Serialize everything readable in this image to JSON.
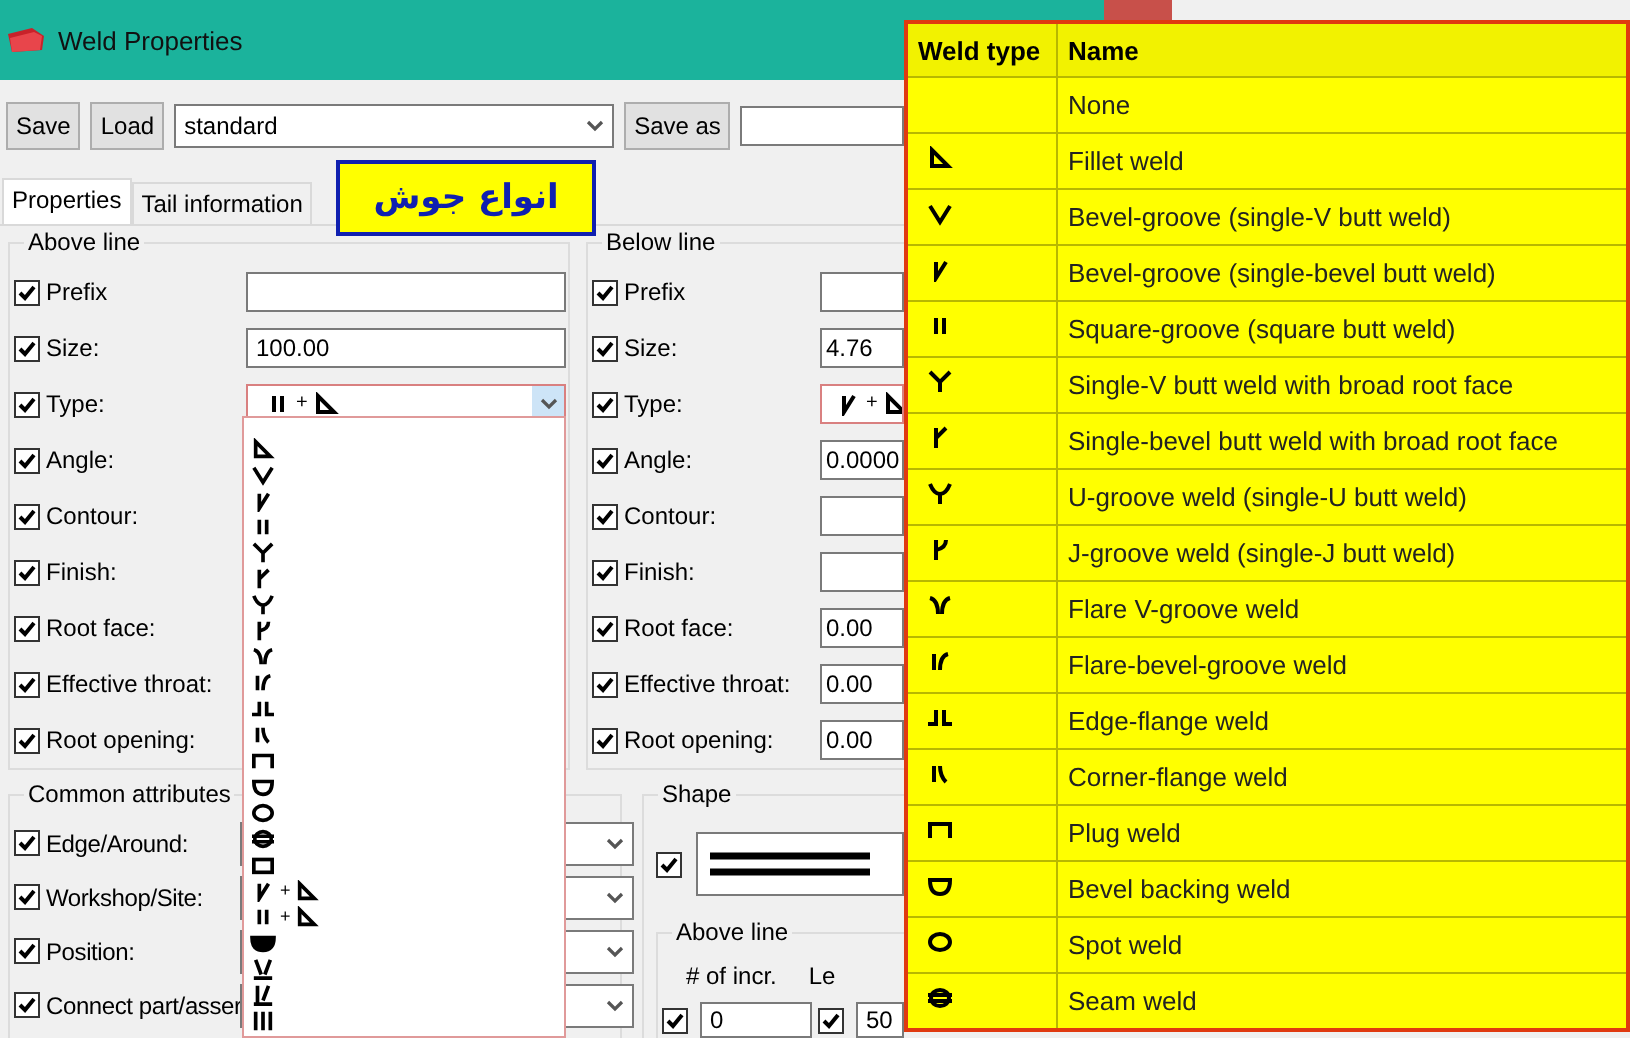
{
  "window": {
    "title": "Weld Properties"
  },
  "toolbar": {
    "buttons": [
      "Save",
      "Load"
    ],
    "preset": "standard",
    "save_as": "Save as"
  },
  "tabs": [
    {
      "label": "Properties",
      "selected": true
    },
    {
      "label": "Tail information",
      "selected": false
    }
  ],
  "annotation": "انواع جوش",
  "above_line": {
    "title": "Above line",
    "rows": [
      {
        "label": "Prefix",
        "checked": true,
        "kind": "text"
      },
      {
        "label": "Size:",
        "checked": true,
        "kind": "text",
        "value": "100.00"
      },
      {
        "label": "Type:",
        "checked": true,
        "kind": "type",
        "symbol": {
          "kind": "square_fillet",
          "joiner": "+"
        }
      },
      {
        "label": "Angle:",
        "checked": true,
        "kind": "plain"
      },
      {
        "label": "Contour:",
        "checked": true,
        "kind": "plain"
      },
      {
        "label": "Finish:",
        "checked": true,
        "kind": "plain"
      },
      {
        "label": "Root face:",
        "checked": true,
        "kind": "plain"
      },
      {
        "label": "Effective throat:",
        "checked": true,
        "kind": "plain"
      },
      {
        "label": "Root opening:",
        "checked": true,
        "kind": "plain"
      }
    ],
    "type_list": [
      {
        "kind": "fillet"
      },
      {
        "kind": "v"
      },
      {
        "kind": "bevel"
      },
      {
        "kind": "square"
      },
      {
        "kind": "y"
      },
      {
        "kind": "bevel_root"
      },
      {
        "kind": "u"
      },
      {
        "kind": "j"
      },
      {
        "kind": "flare_v"
      },
      {
        "kind": "flare_bevel"
      },
      {
        "kind": "edge_flange"
      },
      {
        "kind": "corner_flange"
      },
      {
        "kind": "plug"
      },
      {
        "kind": "bevel_backing"
      },
      {
        "kind": "spot"
      },
      {
        "kind": "seam"
      },
      {
        "kind": "rect"
      },
      {
        "kind": "bevel_fillet",
        "joiner": "+"
      },
      {
        "kind": "square_fillet",
        "joiner": "+"
      },
      {
        "kind": "melt"
      },
      {
        "kind": "v_bar"
      },
      {
        "kind": "bevel_bar"
      },
      {
        "kind": "triple"
      }
    ]
  },
  "below_line": {
    "title": "Below line",
    "rows": [
      {
        "label": "Prefix",
        "checked": true,
        "kind": "text"
      },
      {
        "label": "Size:",
        "checked": true,
        "kind": "text",
        "value": "4.76"
      },
      {
        "label": "Type:",
        "checked": true,
        "kind": "type",
        "symbol": {
          "kind": "bevel_fillet",
          "joiner": "+"
        }
      },
      {
        "label": "Angle:",
        "checked": true,
        "kind": "text",
        "value": "0.0000"
      },
      {
        "label": "Contour:",
        "checked": true,
        "kind": "text"
      },
      {
        "label": "Finish:",
        "checked": true,
        "kind": "text"
      },
      {
        "label": "Root face:",
        "checked": true,
        "kind": "text",
        "value": "0.00"
      },
      {
        "label": "Effective throat:",
        "checked": true,
        "kind": "text",
        "value": "0.00"
      },
      {
        "label": "Root opening:",
        "checked": true,
        "kind": "text",
        "value": "0.00"
      }
    ]
  },
  "common_attributes": {
    "title": "Common attributes",
    "rows": [
      {
        "label": "Edge/Around:",
        "checked": true
      },
      {
        "label": "Workshop/Site:",
        "checked": true
      },
      {
        "label": "Position:",
        "checked": true
      },
      {
        "label": "Connect part/asser",
        "checked": true
      }
    ]
  },
  "shape": {
    "title": "Shape",
    "checked": true,
    "above_line": {
      "title": "Above line",
      "columns": [
        "# of incr.",
        "Le"
      ],
      "fields": [
        {
          "checked": true,
          "value": "0"
        },
        {
          "checked": true,
          "value": "50"
        }
      ]
    }
  },
  "weld_types": {
    "columns": [
      "Weld type",
      "Name"
    ],
    "rows": [
      {
        "name": "None"
      },
      {
        "name": "Fillet weld",
        "kind": "fillet"
      },
      {
        "name": "Bevel-groove (single-V butt weld)",
        "kind": "v"
      },
      {
        "name": "Bevel-groove (single-bevel butt weld)",
        "kind": "bevel"
      },
      {
        "name": "Square-groove (square butt weld)",
        "kind": "square"
      },
      {
        "name": "Single-V butt weld with broad root face",
        "kind": "y"
      },
      {
        "name": "Single-bevel butt weld with broad root face",
        "kind": "bevel_root"
      },
      {
        "name": "U-groove weld (single-U butt weld)",
        "kind": "u"
      },
      {
        "name": "J-groove weld (single-J butt weld)",
        "kind": "j"
      },
      {
        "name": "Flare V-groove weld",
        "kind": "flare_v"
      },
      {
        "name": "Flare-bevel-groove weld",
        "kind": "flare_bevel"
      },
      {
        "name": "Edge-flange weld",
        "kind": "edge_flange"
      },
      {
        "name": "Corner-flange weld",
        "kind": "corner_flange"
      },
      {
        "name": "Plug weld",
        "kind": "plug"
      },
      {
        "name": "Bevel backing weld",
        "kind": "bevel_backing"
      },
      {
        "name": "Spot weld",
        "kind": "spot"
      },
      {
        "name": "Seam weld",
        "kind": "seam"
      }
    ]
  }
}
